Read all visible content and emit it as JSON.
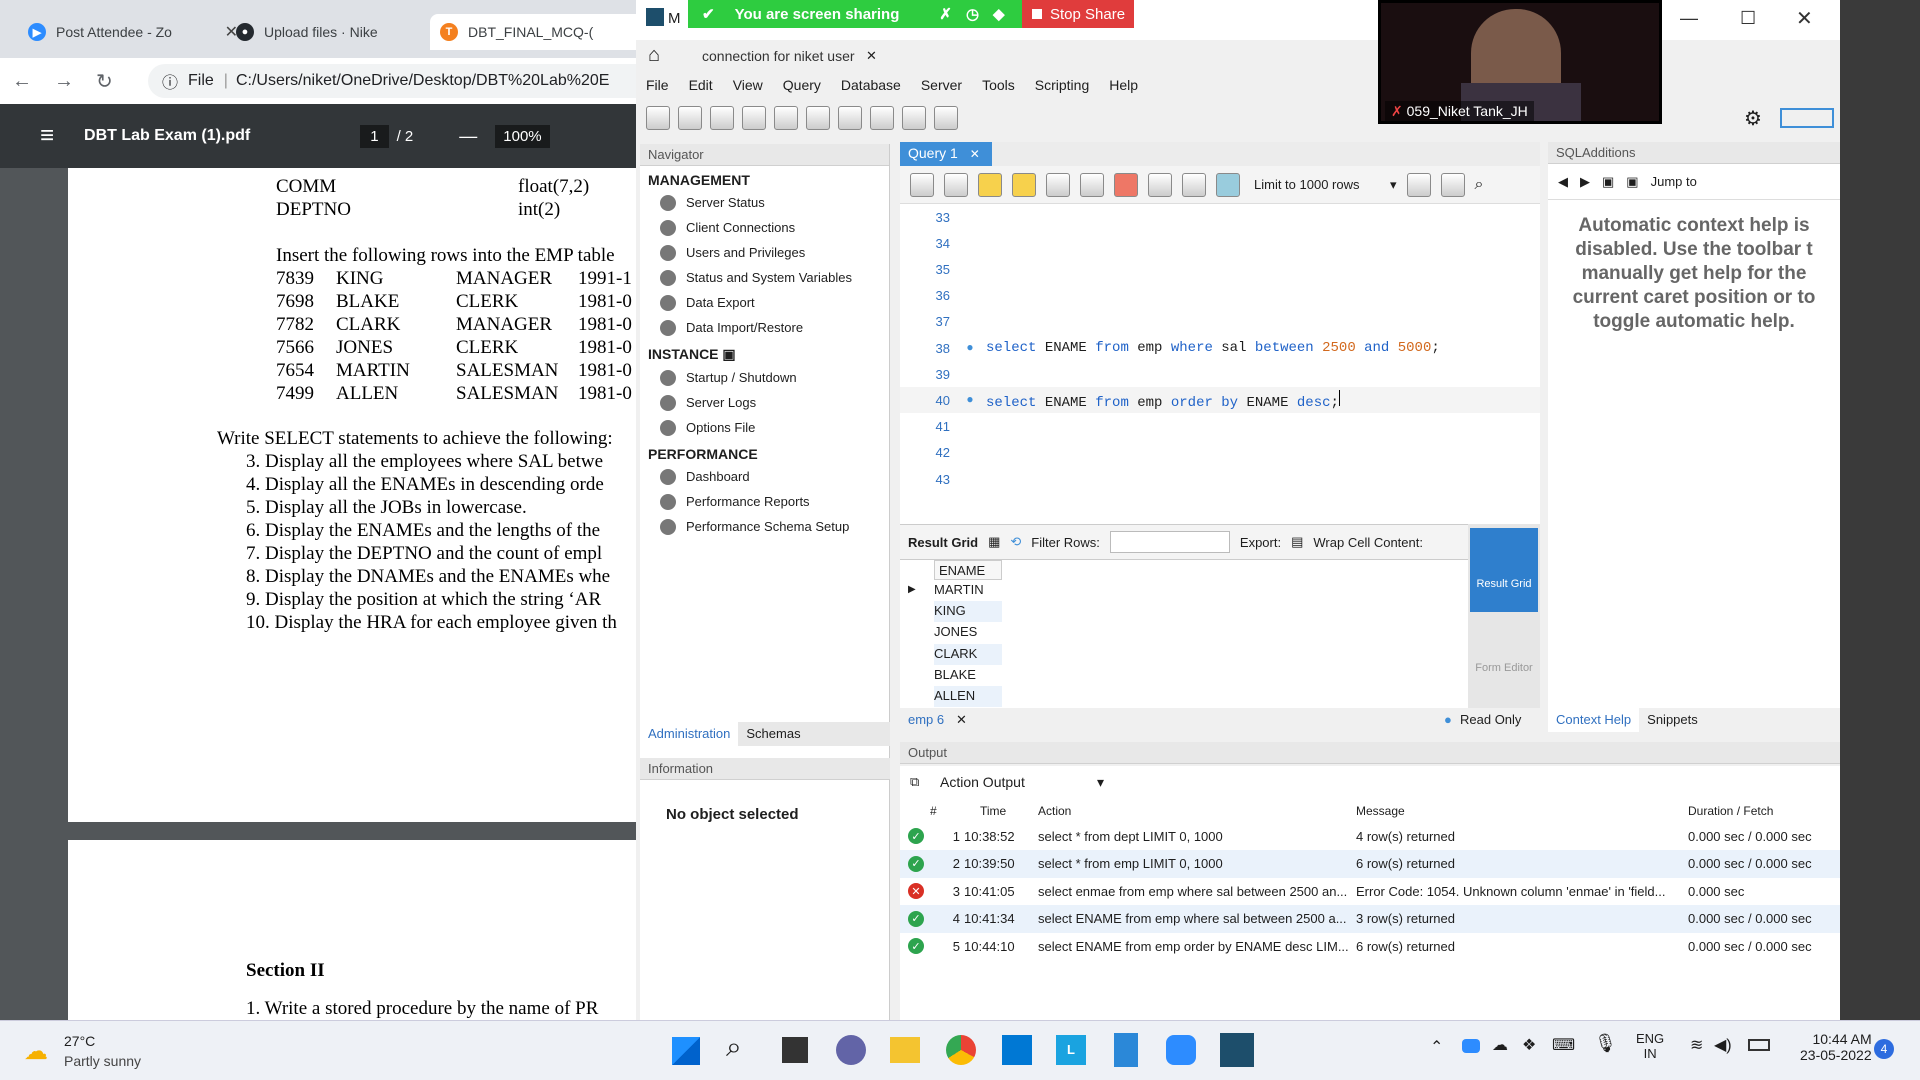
{
  "browser": {
    "tabs": [
      {
        "title": "Post Attendee - Zo",
        "color": "#2d8cff"
      },
      {
        "title": "Upload files · Nike",
        "color": "#24292f"
      },
      {
        "title": "DBT_FINAL_MCQ-(",
        "color": "#f4801f"
      }
    ],
    "address_prefix": "File",
    "address": "C:/Users/niket/OneDrive/Desktop/DBT%20Lab%20E"
  },
  "pdf": {
    "title": "DBT Lab Exam (1).pdf",
    "page_current": "1",
    "page_sep": "/ 2",
    "zoom": "100%",
    "cols": [
      [
        "COMM",
        "float(7,2)"
      ],
      [
        "DEPTNO",
        "int(2)"
      ]
    ],
    "insert_text": "Insert the following rows into the EMP table",
    "rows": [
      [
        "7839",
        "KING",
        "MANAGER",
        "1991-1"
      ],
      [
        "7698",
        "BLAKE",
        "CLERK",
        "1981-0"
      ],
      [
        "7782",
        "CLARK",
        "MANAGER",
        "1981-0"
      ],
      [
        "7566",
        "JONES",
        "CLERK",
        "1981-0"
      ],
      [
        "7654",
        "MARTIN",
        "SALESMAN",
        "1981-0"
      ],
      [
        "7499",
        "ALLEN",
        "SALESMAN",
        "1981-0"
      ]
    ],
    "write_text": "Write SELECT statements to achieve the following:",
    "questions": [
      "3.   Display all the employees where SAL betwe",
      "4.   Display all the ENAMEs in descending orde",
      "5.   Display all the JOBs in lowercase.",
      "6.   Display the ENAMEs and the lengths of the",
      "7.   Display the DEPTNO and the count of empl",
      "8.   Display the DNAMEs and the ENAMEs whe",
      "9.   Display the position at which the string ‘AR",
      "10. Display the HRA for each employee given th"
    ],
    "section": "Section II",
    "next_line": "1.   Write a stored procedure by the name of PR"
  },
  "share": {
    "label": "You are screen sharing",
    "stop": "Stop Share"
  },
  "video": {
    "name": "059_Niket Tank_JH"
  },
  "wb": {
    "title": "M",
    "conn_tab": "connection for niket user",
    "menu": [
      "File",
      "Edit",
      "View",
      "Query",
      "Database",
      "Server",
      "Tools",
      "Scripting",
      "Help"
    ],
    "navigator": "Navigator",
    "management": "MANAGEMENT",
    "mgmt_items": [
      "Server Status",
      "Client Connections",
      "Users and Privileges",
      "Status and System Variables",
      "Data Export",
      "Data Import/Restore"
    ],
    "instance": "INSTANCE",
    "inst_items": [
      "Startup / Shutdown",
      "Server Logs",
      "Options File"
    ],
    "performance": "PERFORMANCE",
    "perf_items": [
      "Dashboard",
      "Performance Reports",
      "Performance Schema Setup"
    ],
    "tab_admin": "Administration",
    "tab_schemas": "Schemas",
    "information": "Information",
    "no_object": "No object selected",
    "query_tab": "Query 1",
    "limit": "Limit to 1000 rows",
    "lines": [
      {
        "n": "33",
        "t": ""
      },
      {
        "n": "34",
        "t": ""
      },
      {
        "n": "35",
        "t": ""
      },
      {
        "n": "36",
        "t": ""
      },
      {
        "n": "37",
        "t": ""
      },
      {
        "n": "38",
        "t": "q1"
      },
      {
        "n": "39",
        "t": ""
      },
      {
        "n": "40",
        "t": "q2"
      },
      {
        "n": "41",
        "t": ""
      },
      {
        "n": "42",
        "t": ""
      },
      {
        "n": "43",
        "t": ""
      }
    ],
    "q1": {
      "a": "select",
      "b": " ENAME ",
      "c": "from",
      "d": " emp ",
      "e": "where",
      "f": " sal ",
      "g": "between",
      "h": " ",
      "i": "2500",
      "j": " ",
      "k": "and",
      "l": " ",
      "m": "5000",
      "n": ";"
    },
    "q2": {
      "a": "select",
      "b": " ENAME ",
      "c": "from",
      "d": " emp ",
      "e": "order by",
      "f": " ENAME ",
      "g": "desc",
      "h": ";"
    },
    "result_grid": "Result Grid",
    "filter_rows": "Filter Rows:",
    "export": "Export:",
    "wrap": "Wrap Cell Content:",
    "col": "ENAME",
    "names": [
      "MARTIN",
      "KING",
      "JONES",
      "CLARK",
      "BLAKE",
      "ALLEN"
    ],
    "side_result": "Result Grid",
    "side_form": "Form Editor",
    "emp_tab": "emp 6",
    "read_only": "Read Only",
    "context_help": "Context Help",
    "snippets": "Snippets",
    "sqladd": "SQLAdditions",
    "jump": "Jump to",
    "help": "Automatic context help is disabled. Use the toolbar t manually get help for the current caret position or to toggle automatic help.",
    "output": "Output",
    "action_output": "Action Output",
    "out_headers": [
      "#",
      "Time",
      "Action",
      "Message",
      "Duration / Fetch"
    ],
    "out_rows": [
      {
        "s": "ok",
        "n": "1",
        "t": "10:38:52",
        "a": "select * from dept LIMIT 0, 1000",
        "m": "4 row(s) returned",
        "d": "0.000 sec / 0.000 sec"
      },
      {
        "s": "ok",
        "n": "2",
        "t": "10:39:50",
        "a": "select * from emp LIMIT 0, 1000",
        "m": "6 row(s) returned",
        "d": "0.000 sec / 0.000 sec"
      },
      {
        "s": "err",
        "n": "3",
        "t": "10:41:05",
        "a": "select enmae from emp where sal between 2500 an...",
        "m": "Error Code: 1054. Unknown column 'enmae' in 'field...",
        "d": "0.000 sec"
      },
      {
        "s": "ok",
        "n": "4",
        "t": "10:41:34",
        "a": "select ENAME from emp where sal between 2500 a...",
        "m": "3 row(s) returned",
        "d": "0.000 sec / 0.000 sec"
      },
      {
        "s": "ok",
        "n": "5",
        "t": "10:44:10",
        "a": "select ENAME from emp order by ENAME desc LIM...",
        "m": "6 row(s) returned",
        "d": "0.000 sec / 0.000 sec"
      }
    ]
  },
  "taskbar": {
    "temp": "27°C",
    "weather": "Partly sunny",
    "lang1": "ENG",
    "lang2": "IN",
    "time": "10:44 AM",
    "date": "23-05-2022",
    "badge": "4"
  }
}
